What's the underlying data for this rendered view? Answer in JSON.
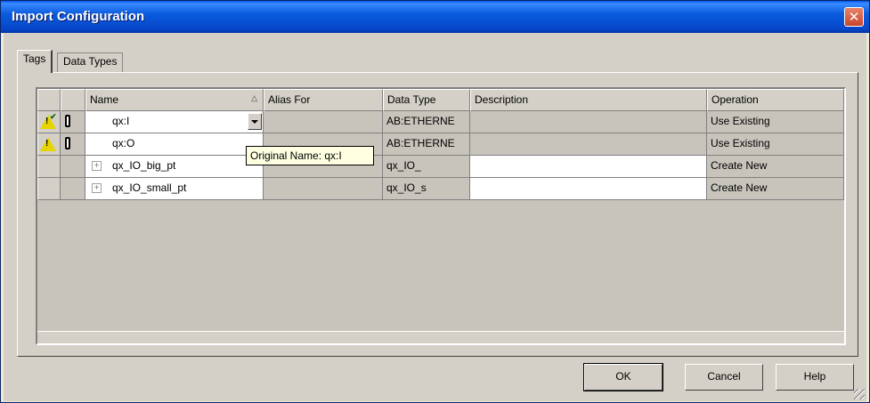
{
  "window": {
    "title": "Import Configuration"
  },
  "tabs": [
    {
      "label": "Tags",
      "active": true
    },
    {
      "label": "Data Types",
      "active": false
    }
  ],
  "grid": {
    "columns": [
      "Name",
      "Alias For",
      "Data Type",
      "Description",
      "Operation"
    ],
    "rows": [
      {
        "status_icon": "warning-check-icon",
        "name": "qx:I",
        "alias_for": "",
        "data_type": "AB:ETHERNE",
        "description": "",
        "operation": "Use Existing",
        "expandable": false
      },
      {
        "status_icon": "warning-icon",
        "name": "qx:O",
        "alias_for": "",
        "data_type": "AB:ETHERNE",
        "description": "",
        "operation": "Use Existing",
        "expandable": false
      },
      {
        "status_icon": "",
        "name": "qx_IO_big_pt",
        "alias_for": "",
        "data_type": "qx_IO_",
        "description": "",
        "operation": "Create New",
        "expandable": true
      },
      {
        "status_icon": "",
        "name": "qx_IO_small_pt",
        "alias_for": "",
        "data_type": "qx_IO_s",
        "description": "",
        "operation": "Create New",
        "expandable": true
      }
    ]
  },
  "tooltip": {
    "text": "Original Name: qx:I"
  },
  "buttons": {
    "ok": "OK",
    "cancel": "Cancel",
    "help": "Help"
  },
  "colors": {
    "titlebar": "#0a5cde",
    "dialog_bg": "#d4d0c8",
    "tooltip_bg": "#ffffe1",
    "warning": "#e6d400"
  }
}
